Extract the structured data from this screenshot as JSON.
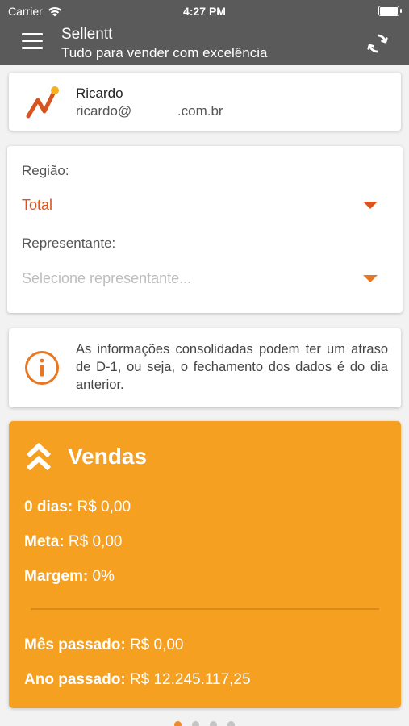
{
  "status_bar": {
    "carrier": "Carrier",
    "time": "4:27 PM"
  },
  "header": {
    "title": "Sellentt",
    "subtitle": "Tudo para vender com excelência",
    "menu_icon": "hamburger-icon",
    "sync_icon": "sync-icon"
  },
  "user": {
    "name": "Ricardo",
    "email": "ricardo@            .com.br"
  },
  "filters": {
    "region_label": "Região:",
    "region_value": "Total",
    "rep_label": "Representante:",
    "rep_placeholder": "Selecione representante..."
  },
  "info": {
    "text": "As informações consolidadas podem ter um atraso de D-1, ou seja, o fechamento dos dados é do dia anterior."
  },
  "sales": {
    "title": "Vendas",
    "rows": [
      {
        "label": "0 dias:",
        "value": "R$ 0,00"
      },
      {
        "label": "Meta:",
        "value": "R$ 0,00"
      },
      {
        "label": "Margem:",
        "value": "0%"
      },
      {
        "label": "Mês passado:",
        "value": "R$ 0,00"
      },
      {
        "label": "Ano passado:",
        "value": "R$ 12.245.117,25"
      }
    ]
  },
  "colors": {
    "header_bg": "#5a5a5a",
    "accent": "#d9541e",
    "sales_bg": "#f6a021"
  },
  "pagination": {
    "pages": 4,
    "current": 1
  }
}
